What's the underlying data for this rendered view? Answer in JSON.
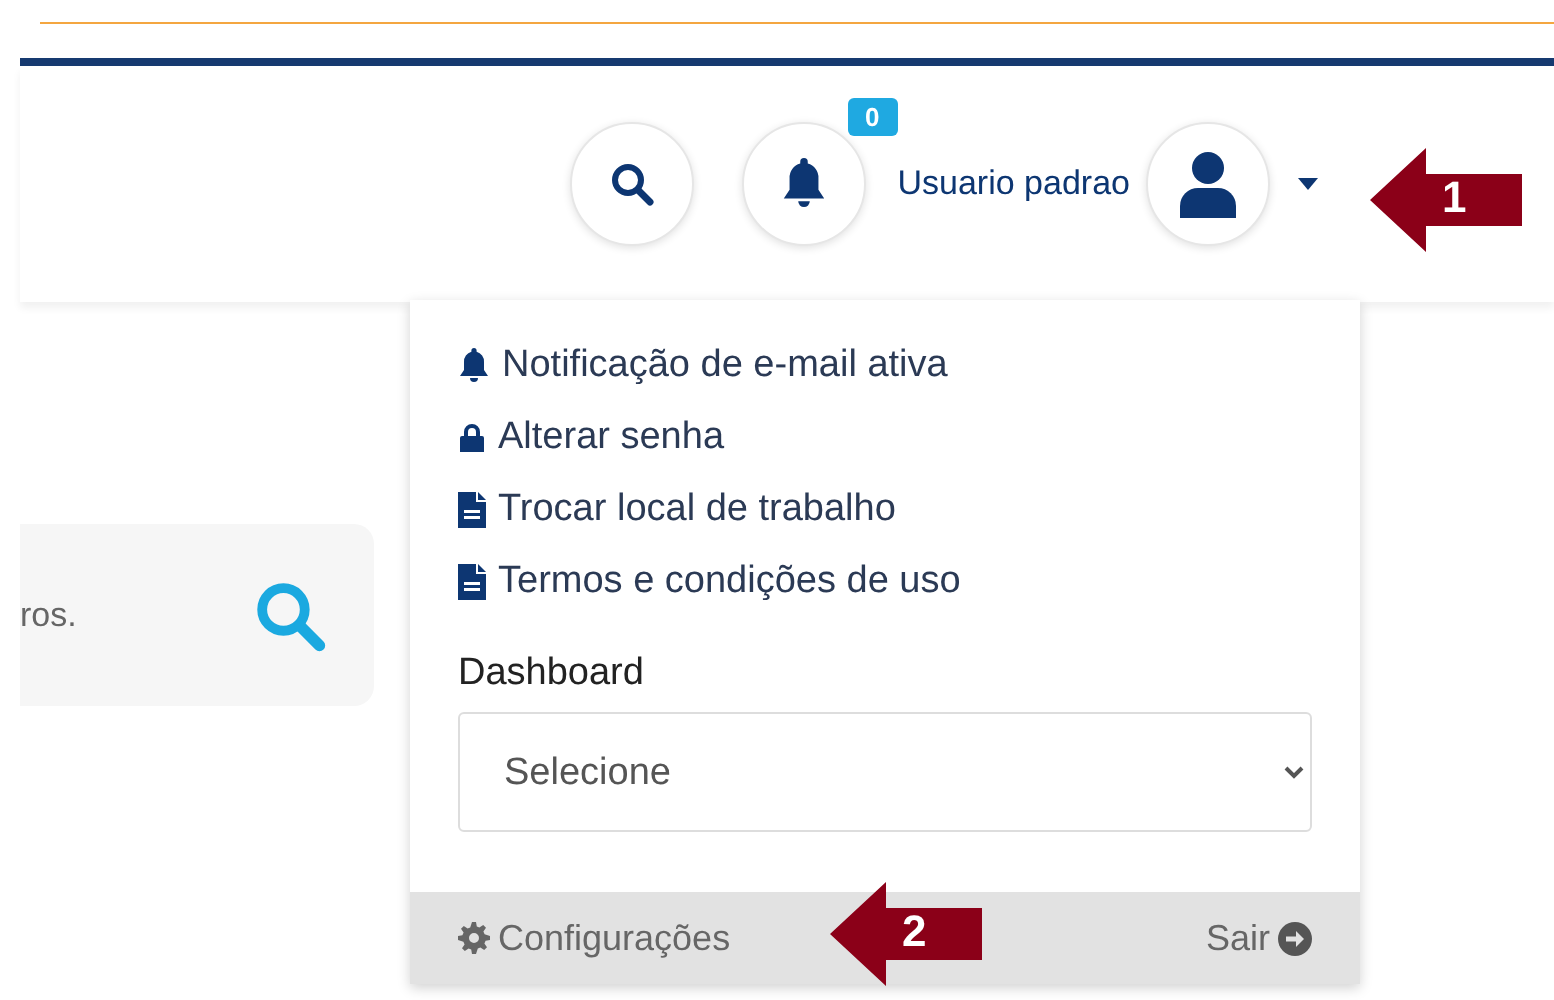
{
  "header": {
    "notifications": {
      "count": "0"
    },
    "user": {
      "name": "Usuario padrao"
    }
  },
  "search": {
    "placeholder": "ros."
  },
  "user_menu": {
    "items": [
      {
        "kind": "bell",
        "label": "Notificação de e-mail ativa"
      },
      {
        "kind": "lock",
        "label": "Alterar senha"
      },
      {
        "kind": "file",
        "label": "Trocar local de trabalho"
      },
      {
        "kind": "file",
        "label": "Termos e condições de uso"
      }
    ],
    "dashboard": {
      "label": "Dashboard",
      "value": "Selecione"
    },
    "footer": {
      "settings": "Configurações",
      "logout": "Sair"
    }
  },
  "annotations": [
    {
      "label": "1"
    },
    {
      "label": "2"
    }
  ]
}
